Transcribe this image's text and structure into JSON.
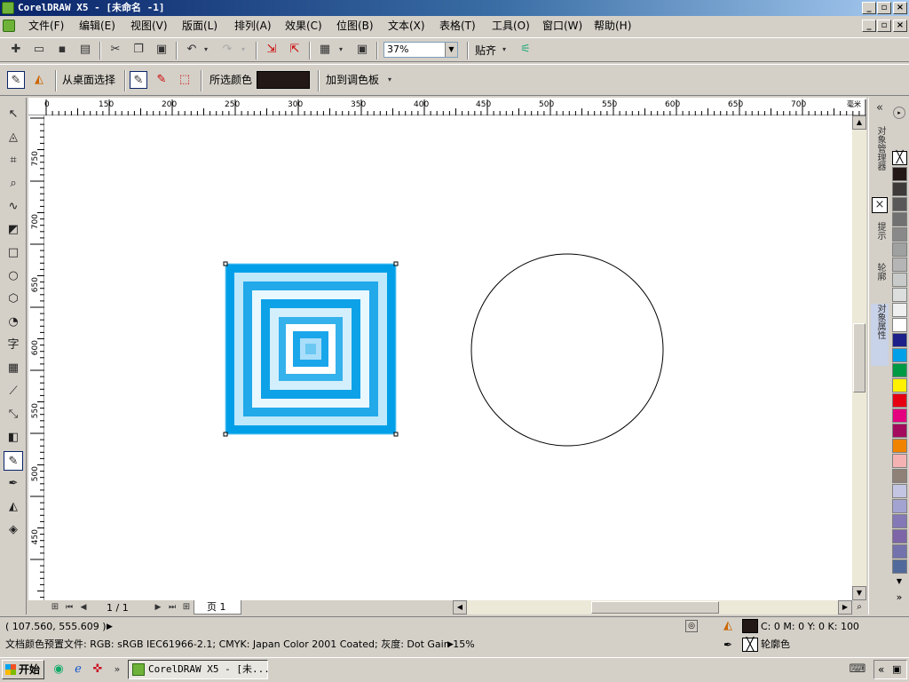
{
  "app": {
    "title": "CorelDRAW X5 - [未命名 -1]"
  },
  "menu": [
    "文件(F)",
    "编辑(E)",
    "视图(V)",
    "版面(L)",
    "排列(A)",
    "效果(C)",
    "位图(B)",
    "文本(X)",
    "表格(T)",
    "工具(O)",
    "窗口(W)",
    "帮助(H)"
  ],
  "toolbar": {
    "zoom": "37%",
    "snap_label": "贴齐"
  },
  "propbar": {
    "from_desktop": "从桌面选择",
    "selected_color": "所选颜色",
    "add_palette": "加到调色板",
    "selected_color_hex": "#231815"
  },
  "ruler": {
    "unit": "毫米",
    "h_ticks": [
      "0",
      "150",
      "200",
      "250",
      "300",
      "350",
      "400",
      "450",
      "500",
      "550",
      "600",
      "650",
      "700"
    ],
    "v_ticks": [
      "750",
      "700",
      "650",
      "600",
      "550",
      "500",
      "450"
    ]
  },
  "pagenav": {
    "count": "1 / 1",
    "tab": "页 1"
  },
  "docker": {
    "tabs": [
      "对象管理器",
      "提示",
      "轮廓",
      "对象属性"
    ]
  },
  "palette": [
    "#231815",
    "#3e3a39",
    "#595757",
    "#727171",
    "#898989",
    "#9fa0a0",
    "#b5b5b6",
    "#c9caca",
    "#dcdddd",
    "#efefef",
    "#ffffff",
    "#1d2088",
    "#00a0e9",
    "#009944",
    "#fff100",
    "#e60012",
    "#e4007f",
    "#a40b5d",
    "#f08300",
    "#f5b2b2",
    "#8f8178",
    "#c4c5e2",
    "#a3a3d2",
    "#8478b6",
    "#7d65a8",
    "#7372ad",
    "#516a9b"
  ],
  "status": {
    "coords": "( 107.560, 555.609 )",
    "fill_info": "C: 0 M: 0 Y: 0 K: 100",
    "outline_label": "轮廓色",
    "doc_profile": "文档颜色预置文件: RGB: sRGB IEC61966-2.1; CMYK: Japan Color 2001 Coated; 灰度: Dot Gain 15%"
  },
  "taskbar": {
    "start": "开始",
    "task": "CorelDRAW X5 - [未..."
  }
}
